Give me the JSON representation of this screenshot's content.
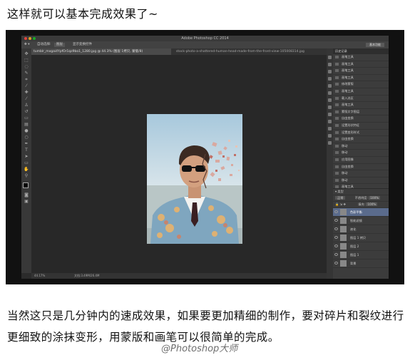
{
  "heading": "这样就可以基本完成效果了~",
  "app": {
    "window_title": "Adobe Photoshop CC 2014",
    "options": [
      "自动选择:",
      "图层",
      "显示变换控件"
    ],
    "workspace": "基本功能",
    "tabs": [
      {
        "label": "tumblr_mxgai4YpfOr1qz9bo1_1280.jpg @ 44.3% (图层 1拷贝, 蒙版/8)",
        "active": true
      },
      {
        "label": "stock-photo-a-shattered-human-head-made-from-the-front-view-105008314.jpg",
        "active": false
      }
    ],
    "status": {
      "zoom": "44.17%",
      "doc": "文档:3.49M/26.4M"
    },
    "history": {
      "title": "历史记录",
      "items": [
        "画笔工具",
        "画笔工具",
        "画笔工具",
        "画笔工具",
        "修改蒙版",
        "画笔工具",
        "载入选区",
        "画笔工具",
        "蒙版文字图层",
        "自由变换",
        "设置形状特征",
        "设置变形样式",
        "自由变换",
        "移动",
        "移动",
        "应用图像",
        "自由变换",
        "移动",
        "移动",
        "画笔工具",
        "画笔工具",
        "画笔工具"
      ],
      "selected_index": 21
    },
    "layers": {
      "mode": "正常",
      "opacity_label": "不透明度:",
      "opacity": "100%",
      "fill_label": "填充:",
      "fill": "100%",
      "items": [
        {
          "name": "色彩平衡",
          "selected": true
        },
        {
          "name": "智能滤镜",
          "selected": false
        },
        {
          "name": "液化",
          "selected": false
        },
        {
          "name": "图层 1 拷贝",
          "selected": false
        },
        {
          "name": "图层 2",
          "selected": false
        },
        {
          "name": "图层 1",
          "selected": false
        },
        {
          "name": "背景",
          "selected": false
        }
      ]
    }
  },
  "body_text": "当然这只是几分钟内的速成效果，如果要更加精细的制作，要对碎片和裂纹进行更细致的涂抹变形，用蒙版和画笔可以很简单的完成。",
  "watermark": "@Photoshop大师"
}
